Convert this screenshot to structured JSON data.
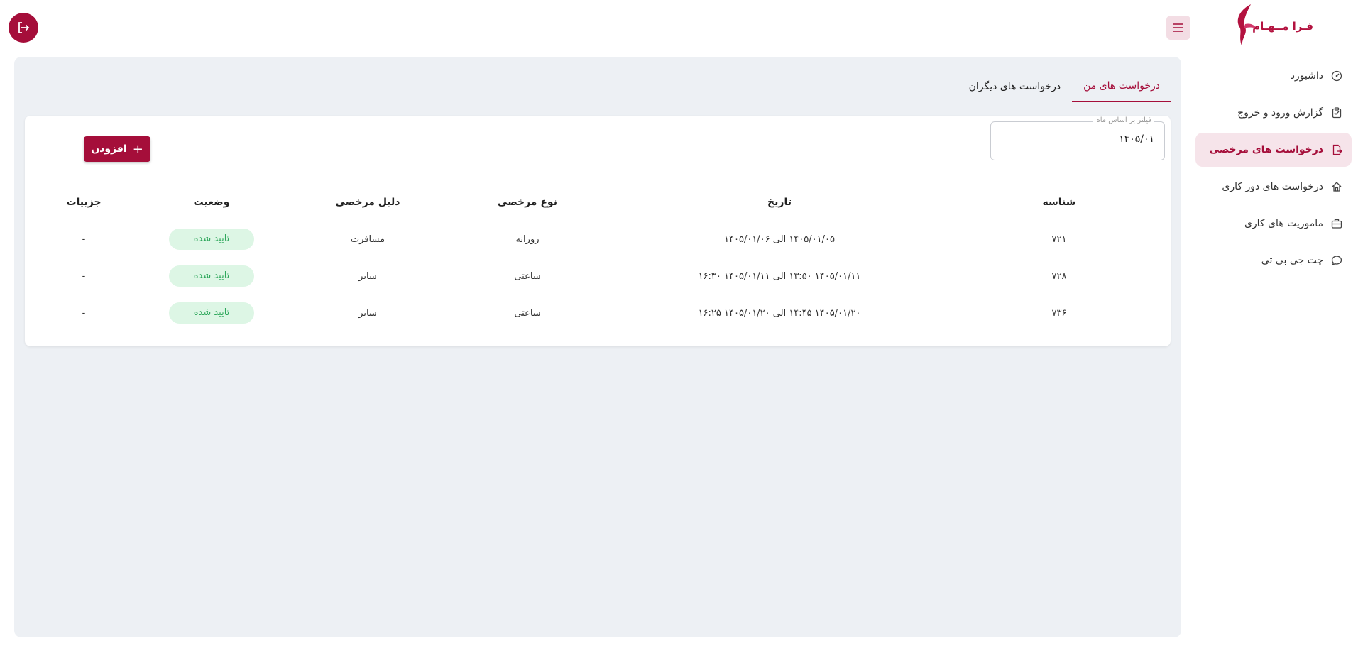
{
  "app": {
    "logo_text": "فـرا مــهـام"
  },
  "sidebar": {
    "items": [
      {
        "label": "داشبورد",
        "icon": "dashboard-icon",
        "active": false
      },
      {
        "label": "گزارش ورود و خروج",
        "icon": "clipboard-icon",
        "active": false
      },
      {
        "label": "درخواست های مرخصی",
        "icon": "file-export-icon",
        "active": true
      },
      {
        "label": "درخواست های دور کاری",
        "icon": "home-icon",
        "active": false
      },
      {
        "label": "ماموریت های کاری",
        "icon": "briefcase-icon",
        "active": false
      },
      {
        "label": "چت جی بی تی",
        "icon": "chat-icon",
        "active": false
      }
    ]
  },
  "tabs": [
    {
      "label": "درخواست های من",
      "active": true
    },
    {
      "label": "درخواست های دیگران",
      "active": false
    }
  ],
  "filter": {
    "legend": "فیلتر بر اساس ماه",
    "value": "۱۴۰۵/۰۱"
  },
  "add_button": {
    "label": "افزودن",
    "icon": "plus-icon"
  },
  "table": {
    "headers": {
      "id": "شناسه",
      "date": "تاریخ",
      "type": "نوع مرخصی",
      "reason": "دلیل مرخصی",
      "status": "وضعیت",
      "details": "جزییات"
    },
    "rows": [
      {
        "id": "۷۲۱",
        "date": "۱۴۰۵/۰۱/۰۵  الی ۱۴۰۵/۰۱/۰۶",
        "type": "روزانه",
        "reason": "مسافرت",
        "status": "تایید شده",
        "details": "-"
      },
      {
        "id": "۷۲۸",
        "date": "۱۴۰۵/۰۱/۱۱ ۱۳:۵۰  الی ۱۴۰۵/۰۱/۱۱ ۱۶:۳۰",
        "type": "ساعتی",
        "reason": "سایر",
        "status": "تایید شده",
        "details": "-"
      },
      {
        "id": "۷۳۶",
        "date": "۱۴۰۵/۰۱/۲۰ ۱۴:۴۵  الی ۱۴۰۵/۰۱/۲۰ ۱۶:۲۵",
        "type": "ساعتی",
        "reason": "سایر",
        "status": "تایید شده",
        "details": "-"
      }
    ]
  },
  "colors": {
    "brand": "#a50e3a",
    "active_bg": "#f6e4ea",
    "panel_bg": "#edf0f4",
    "badge_bg": "#ddf6e5",
    "badge_text": "#2fa85c"
  }
}
